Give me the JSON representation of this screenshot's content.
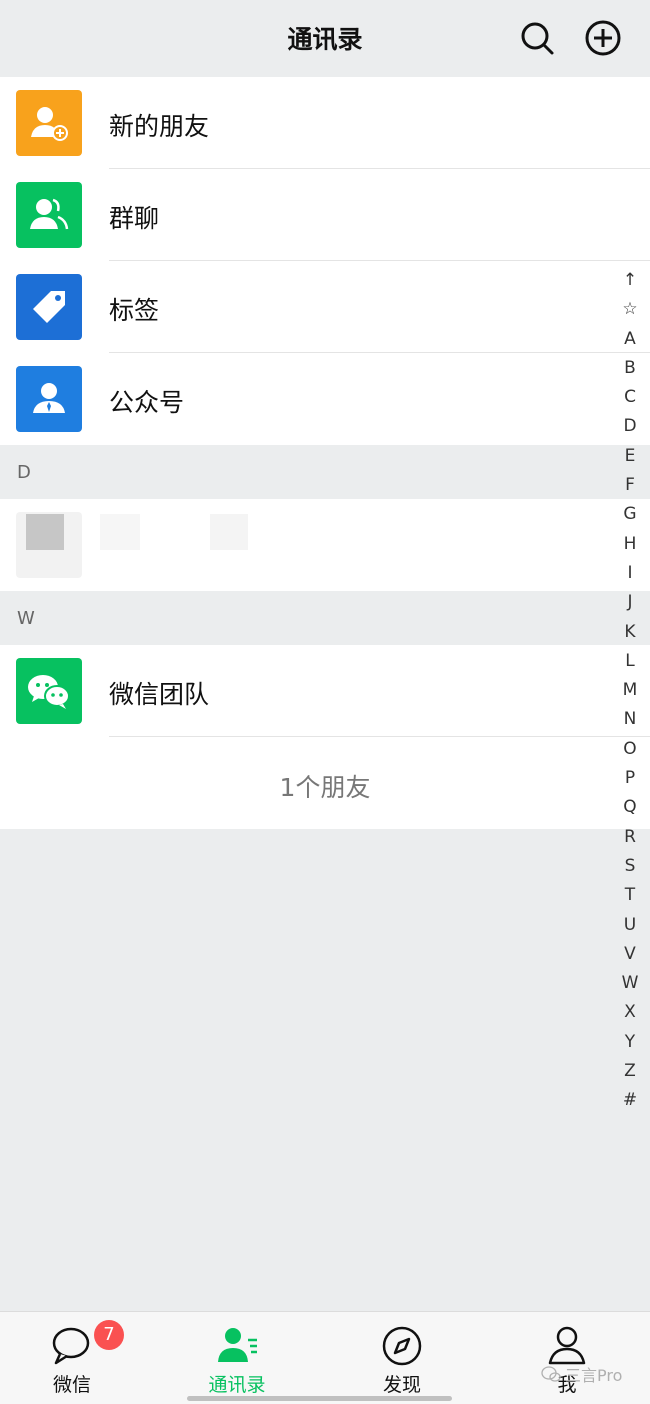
{
  "header": {
    "title": "通讯录"
  },
  "function_rows": [
    {
      "label": "新的朋友",
      "icon": "new-friend-icon",
      "color": "#f8a21c"
    },
    {
      "label": "群聊",
      "icon": "group-chat-icon",
      "color": "#07c160"
    },
    {
      "label": "标签",
      "icon": "tag-icon",
      "color": "#1d6fd6"
    },
    {
      "label": "公众号",
      "icon": "official-account-icon",
      "color": "#1f7ee0"
    }
  ],
  "sections": [
    {
      "letter": "D"
    },
    {
      "letter": "W"
    }
  ],
  "contacts": {
    "wechat_team": {
      "label": "微信团队",
      "icon": "wechat-logo-icon"
    },
    "friend_count": "1个朋友"
  },
  "index_bar": [
    "↑",
    "☆",
    "A",
    "B",
    "C",
    "D",
    "E",
    "F",
    "G",
    "H",
    "I",
    "J",
    "K",
    "L",
    "M",
    "N",
    "O",
    "P",
    "Q",
    "R",
    "S",
    "T",
    "U",
    "V",
    "W",
    "X",
    "Y",
    "Z",
    "#"
  ],
  "tabbar": {
    "tabs": [
      {
        "label": "微信",
        "icon": "chat-icon",
        "badge": "7"
      },
      {
        "label": "通讯录",
        "icon": "contacts-icon",
        "active": true
      },
      {
        "label": "发现",
        "icon": "compass-icon"
      },
      {
        "label": "我",
        "icon": "person-icon"
      }
    ]
  },
  "watermark": {
    "text": "三言Pro"
  },
  "colors": {
    "accent": "#07c160",
    "badge": "#fa5151"
  }
}
